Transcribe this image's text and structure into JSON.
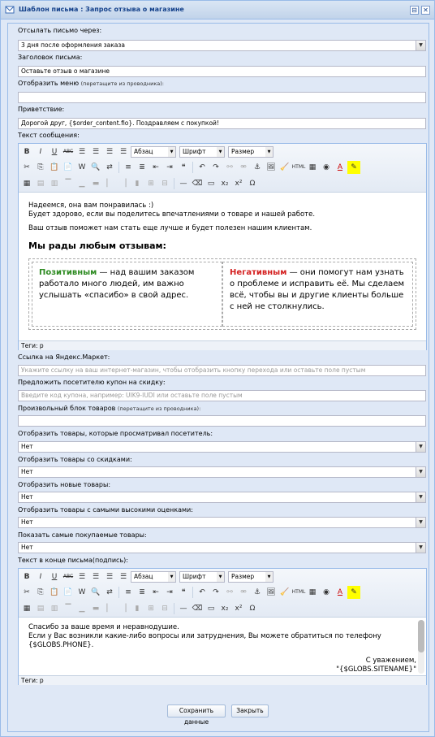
{
  "window": {
    "title": "Шаблон письма : Запрос отзыва о магазине",
    "minimize": "⊟",
    "close": "✕"
  },
  "fields": {
    "send_via_label": "Отсылать письмо через:",
    "send_via_value": "3 дня после оформления заказа",
    "subject_label": "Заголовок письма:",
    "subject_value": "Оставьте отзыв о магазине",
    "menu_label": "Отобразить меню",
    "menu_hint": "(перетащите из проводника):",
    "greeting_label": "Приветствие:",
    "greeting_value": "Дорогой друг, {$order_content.fio}. Поздравляем с покупкой!",
    "message_label": "Текст сообщения:",
    "market_label": "Ссылка на Яндекс.Маркет:",
    "market_placeholder": "Укажите ссылку на ваш интернет-магазин, чтобы отобразить кнопку перехода или оставьте поле пустым",
    "coupon_label": "Предложить посетителю купон на скидку:",
    "coupon_placeholder": "Введите код купона, например: UIK9-IUDI или оставьте поле пустым",
    "products_label": "Произвольный блок товаров",
    "products_hint": "(перетащите из проводника):",
    "viewed_label": "Отобразить товары, которые просматривал посетитель:",
    "viewed_value": "Нет",
    "discount_label": "Отобразить товары со скидками:",
    "discount_value": "Нет",
    "new_label": "Отобразить новые товары:",
    "new_value": "Нет",
    "rated_label": "Отобразить товары с самыми высокими оценками:",
    "rated_value": "Нет",
    "popular_label": "Показать самые покупаемые товары:",
    "popular_value": "Нет",
    "signature_label": "Текст в конце письма(подпись):"
  },
  "toolbar": {
    "format": "Абзац",
    "font": "Шрифт",
    "size": "Размер",
    "bold": "B",
    "italic": "I",
    "underline": "U",
    "strike": "ABC"
  },
  "message": {
    "line1": "Надеемся, она вам понравилась :)",
    "line2": "Будет здорово, если вы поделитесь впечатлениями о товаре и нашей работе.",
    "line3": "Ваш отзыв поможет нам стать еще лучше и будет полезен нашим клиентам.",
    "heading": "Мы рады любым отзывам:",
    "pos_word": "Позитивным",
    "pos_text": " — над вашим заказом работало много людей, им важно услышать «спасибо» в свой адрес.",
    "neg_word": "Негативным",
    "neg_text": " — они помогут нам узнать о проблеме и исправить её. Мы сделаем всё, чтобы вы и другие клиенты больше с ней не столкнулись.",
    "status": "Теги: p"
  },
  "signature": {
    "line1": "Спасибо за ваше время и неравнодушие.",
    "line2": "Если у Вас возникли какие-либо вопросы или затруднения, Вы можете обратиться по телефону",
    "line3": "{$GLOBS.PHONE}.",
    "regards": "С уважением,",
    "sitename": "\"{$GLOBS.SITENAME}\"",
    "status": "Теги: p"
  },
  "buttons": {
    "save": "Сохранить данные",
    "close": "Закрыть"
  },
  "colors": {
    "positive": "#2e8b22",
    "negative": "#d42020",
    "title": "#15428b"
  }
}
